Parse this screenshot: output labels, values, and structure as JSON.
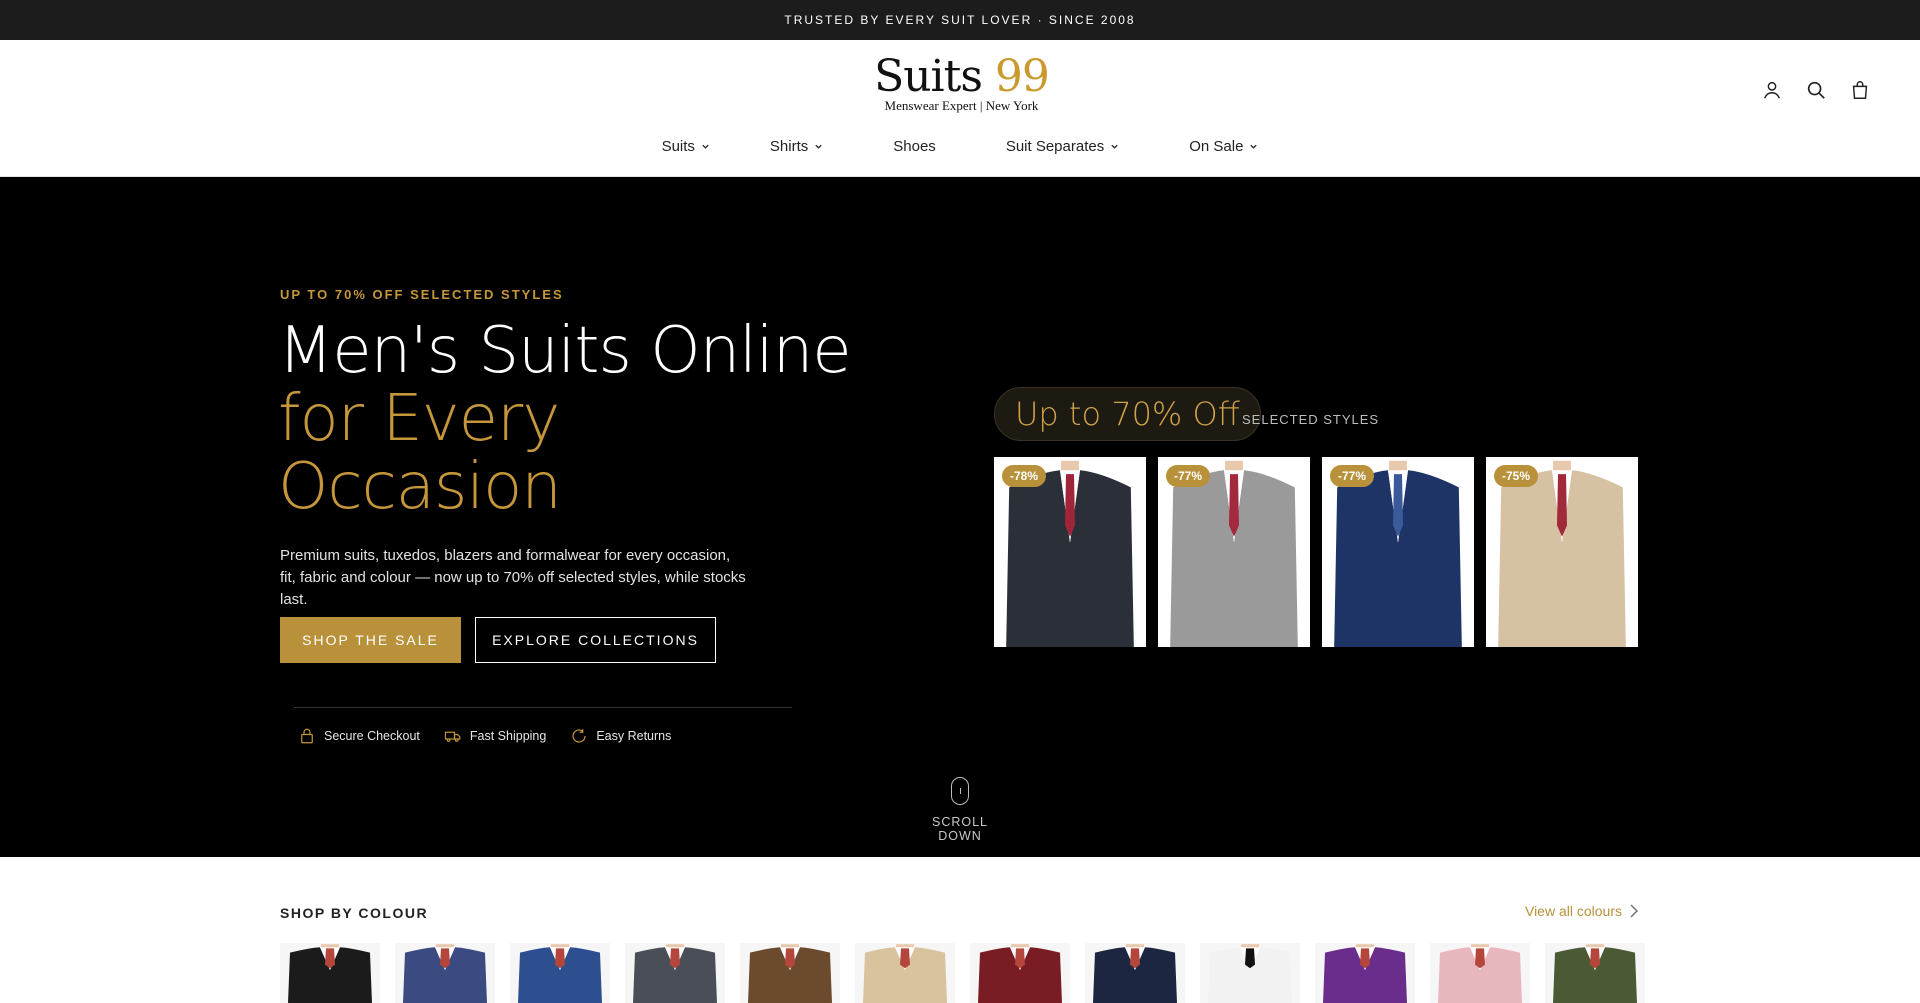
{
  "announcement": "TRUSTED BY EVERY SUIT LOVER · SINCE 2008",
  "logo": {
    "main": "Suits",
    "num": "99",
    "sub": "Menswear Expert | New York"
  },
  "header_icons": [
    "account-icon",
    "search-icon",
    "bag-icon"
  ],
  "nav": [
    {
      "label": "Suits",
      "has_dropdown": true
    },
    {
      "label": "Shirts",
      "has_dropdown": true
    },
    {
      "label": "Shoes",
      "has_dropdown": false
    },
    {
      "label": "Suit Separates",
      "has_dropdown": true
    },
    {
      "label": "On Sale",
      "has_dropdown": true
    }
  ],
  "hero": {
    "eyebrow": "UP TO 70% OFF SELECTED STYLES",
    "title_line1": "Men's Suits Online",
    "title_line2": "for Every",
    "title_line3": "Occasion",
    "description": "Premium suits, tuxedos, blazers and formalwear for every occasion, fit, fabric and colour — now up to 70% off selected styles, while stocks last.",
    "primary_button": "SHOP THE SALE",
    "secondary_button": "EXPLORE COLLECTIONS",
    "trust": [
      {
        "icon": "lock-icon",
        "label": "Secure Checkout"
      },
      {
        "icon": "truck-icon",
        "label": "Fast Shipping"
      },
      {
        "icon": "returns-icon",
        "label": "Easy Returns"
      }
    ],
    "promo_pill": "Up to 70% Off",
    "promo_note": "SELECTED STYLES",
    "products": [
      {
        "badge": "-78%",
        "suit_color": "#2b2f38",
        "tie_color": "#a0243a"
      },
      {
        "badge": "-77%",
        "suit_color": "#9a9a9a",
        "tie_color": "#a32a3c"
      },
      {
        "badge": "-77%",
        "suit_color": "#1f3466",
        "tie_color": "#3a5a9a"
      },
      {
        "badge": "-75%",
        "suit_color": "#d6c1a3",
        "tie_color": "#a02a3a"
      }
    ],
    "scroll_label": "SCROLL DOWN"
  },
  "colours": {
    "title": "SHOP BY COLOUR",
    "view_all": "View all colours",
    "swatches": [
      {
        "color": "#1b1b1b"
      },
      {
        "color": "#3b4a80"
      },
      {
        "color": "#2d4f8f"
      },
      {
        "color": "#4a4f57"
      },
      {
        "color": "#6b4a2e"
      },
      {
        "color": "#d9c39f"
      },
      {
        "color": "#7a1c24"
      },
      {
        "color": "#1d2640"
      },
      {
        "color": "#f2f2f2"
      },
      {
        "color": "#6b2d8c"
      },
      {
        "color": "#e8b7be"
      },
      {
        "color": "#4b5a35"
      }
    ]
  }
}
